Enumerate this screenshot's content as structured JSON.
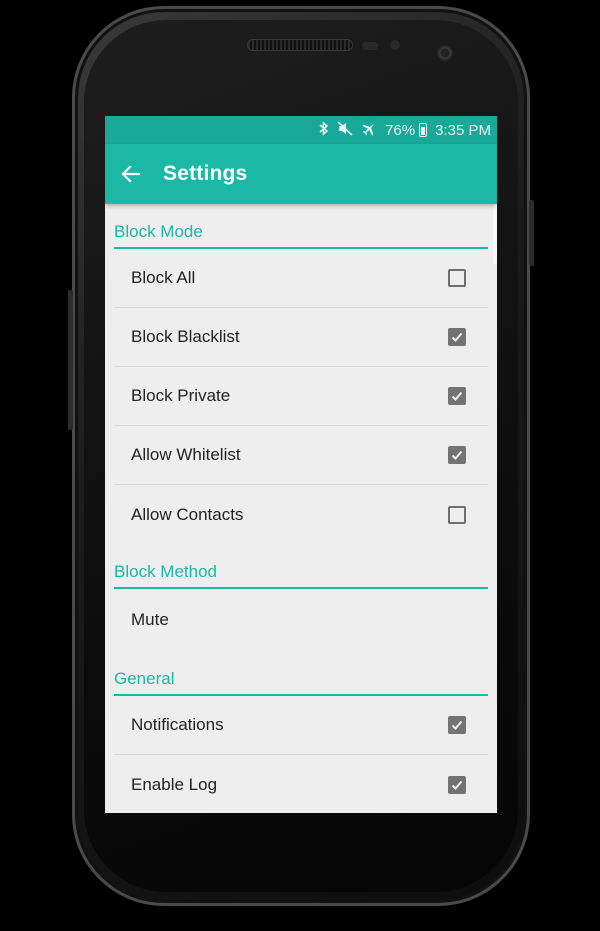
{
  "status_bar": {
    "icons": [
      "bluetooth-icon",
      "mute-icon",
      "airplane-icon"
    ],
    "battery_percent": "76%",
    "time": "3:35 PM"
  },
  "app_bar": {
    "title": "Settings",
    "back_icon": "arrow-left-icon"
  },
  "colors": {
    "accent": "#1ab8a5",
    "status_bar": "#1aa898",
    "background": "#eeeeee"
  },
  "sections": [
    {
      "title": "Block Mode",
      "items": [
        {
          "label": "Block All",
          "checked": false
        },
        {
          "label": "Block Blacklist",
          "checked": true
        },
        {
          "label": "Block Private",
          "checked": true
        },
        {
          "label": "Allow Whitelist",
          "checked": true
        },
        {
          "label": "Allow Contacts",
          "checked": false
        }
      ]
    },
    {
      "title": "Block Method",
      "value": "Mute"
    },
    {
      "title": "General",
      "items": [
        {
          "label": "Notifications",
          "checked": true
        },
        {
          "label": "Enable Log",
          "checked": true
        }
      ]
    }
  ]
}
